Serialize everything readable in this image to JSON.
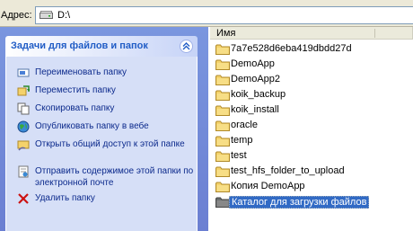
{
  "address": {
    "label": "Адрес:",
    "path": "D:\\"
  },
  "tasks_panel": {
    "title": "Задачи для файлов и папок",
    "collapse_glyph": "«",
    "items": [
      {
        "label": "Переименовать папку",
        "icon": "rename-icon"
      },
      {
        "label": "Переместить папку",
        "icon": "move-icon"
      },
      {
        "label": "Скопировать папку",
        "icon": "copy-icon"
      },
      {
        "label": "Опубликовать папку в вебе",
        "icon": "globe-icon"
      },
      {
        "label": "Открыть общий доступ к этой папке",
        "icon": "share-icon"
      },
      {
        "label": "Отправить содержимое этой папки по электронной почте",
        "icon": "email-icon"
      },
      {
        "label": "Удалить папку",
        "icon": "delete-icon"
      }
    ]
  },
  "file_list": {
    "column_name": "Имя",
    "items": [
      {
        "name": "7a7e528d6eba419dbdd27d"
      },
      {
        "name": "DemoApp"
      },
      {
        "name": "DemoApp2"
      },
      {
        "name": "koik_backup"
      },
      {
        "name": "koik_install"
      },
      {
        "name": "oracle"
      },
      {
        "name": "temp"
      },
      {
        "name": "test"
      },
      {
        "name": "test_hfs_folder_to_upload"
      },
      {
        "name": "Копия DemoApp"
      },
      {
        "name": "Каталог для загрузки файлов",
        "selected": true
      }
    ]
  },
  "colors": {
    "task_link": "#0c2a8c",
    "panel_title": "#215dc6",
    "selection": "#316ac5",
    "folder": "#f4d26b"
  }
}
